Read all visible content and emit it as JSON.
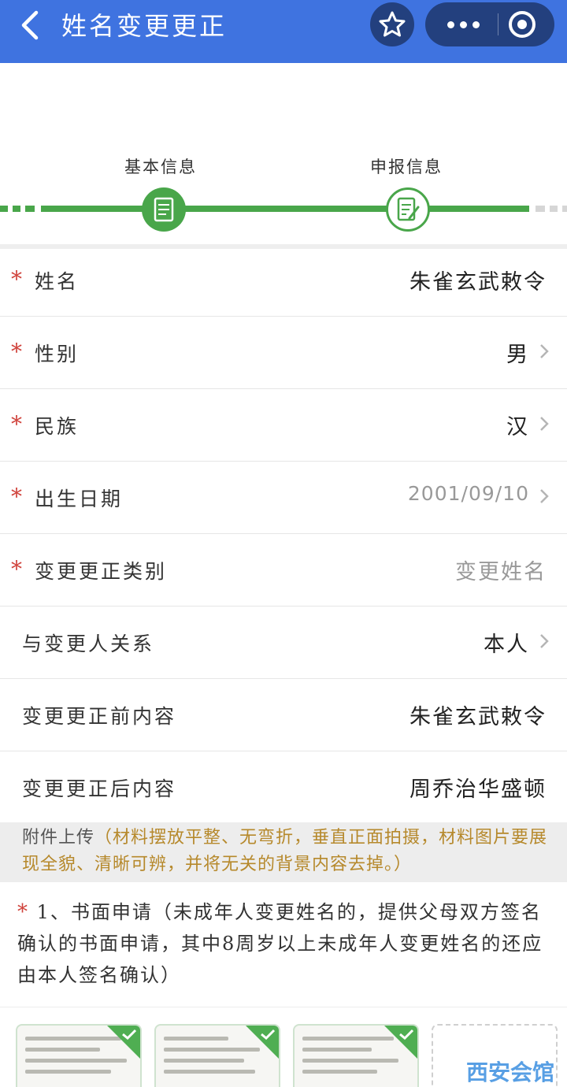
{
  "header": {
    "title": "姓名变更更正",
    "back_icon": "chevron-left-icon",
    "star_icon": "star-icon",
    "more_icon": "more-dots-icon",
    "close_icon": "target-circle-icon"
  },
  "steps": [
    {
      "label": "基本信息",
      "icon": "document-icon",
      "state": "done"
    },
    {
      "label": "申报信息",
      "icon": "edit-document-icon",
      "state": "current"
    }
  ],
  "form": {
    "rows": [
      {
        "label": "姓名",
        "required": true,
        "value": "朱雀玄武敕令",
        "chevron": false
      },
      {
        "label": "性别",
        "required": true,
        "value": "男",
        "chevron": true
      },
      {
        "label": "民族",
        "required": true,
        "value": "汉",
        "chevron": true
      },
      {
        "label": "出生日期",
        "required": true,
        "value": "2001/09/10",
        "chevron": true
      },
      {
        "label": "变更更正类别",
        "required": true,
        "value": "变更姓名",
        "chevron": false
      },
      {
        "label": "与变更人关系",
        "required": false,
        "value": "本人",
        "chevron": true
      },
      {
        "label": "变更更正前内容",
        "required": false,
        "value": "朱雀玄武敕令",
        "chevron": false
      },
      {
        "label": "变更更正后内容",
        "required": false,
        "value": "周乔治华盛顿",
        "chevron": false
      }
    ]
  },
  "attachment": {
    "title": "附件上传",
    "tip": "（材料摆放平整、无弯折，垂直正面拍摄，材料图片要展现全貌、清晰可辨，并将无关的背景内容去掉。）"
  },
  "document": {
    "required_mark": "*",
    "text": " 1、书面申请（未成年人变更姓名的，提供父母双方签名确认的书面申请，其中8周岁以上未成年人变更姓名的还应由本人签名确认）"
  },
  "thumbnails": [
    {
      "status": "uploaded"
    },
    {
      "status": "uploaded"
    },
    {
      "status": "uploaded"
    },
    {
      "status": "add"
    }
  ],
  "watermark": "西安会馆",
  "colors": {
    "header": "#3f73e0",
    "capsule": "#23407e",
    "progress": "#49a64a",
    "required": "#d0433c",
    "tip": "#b6892c"
  }
}
